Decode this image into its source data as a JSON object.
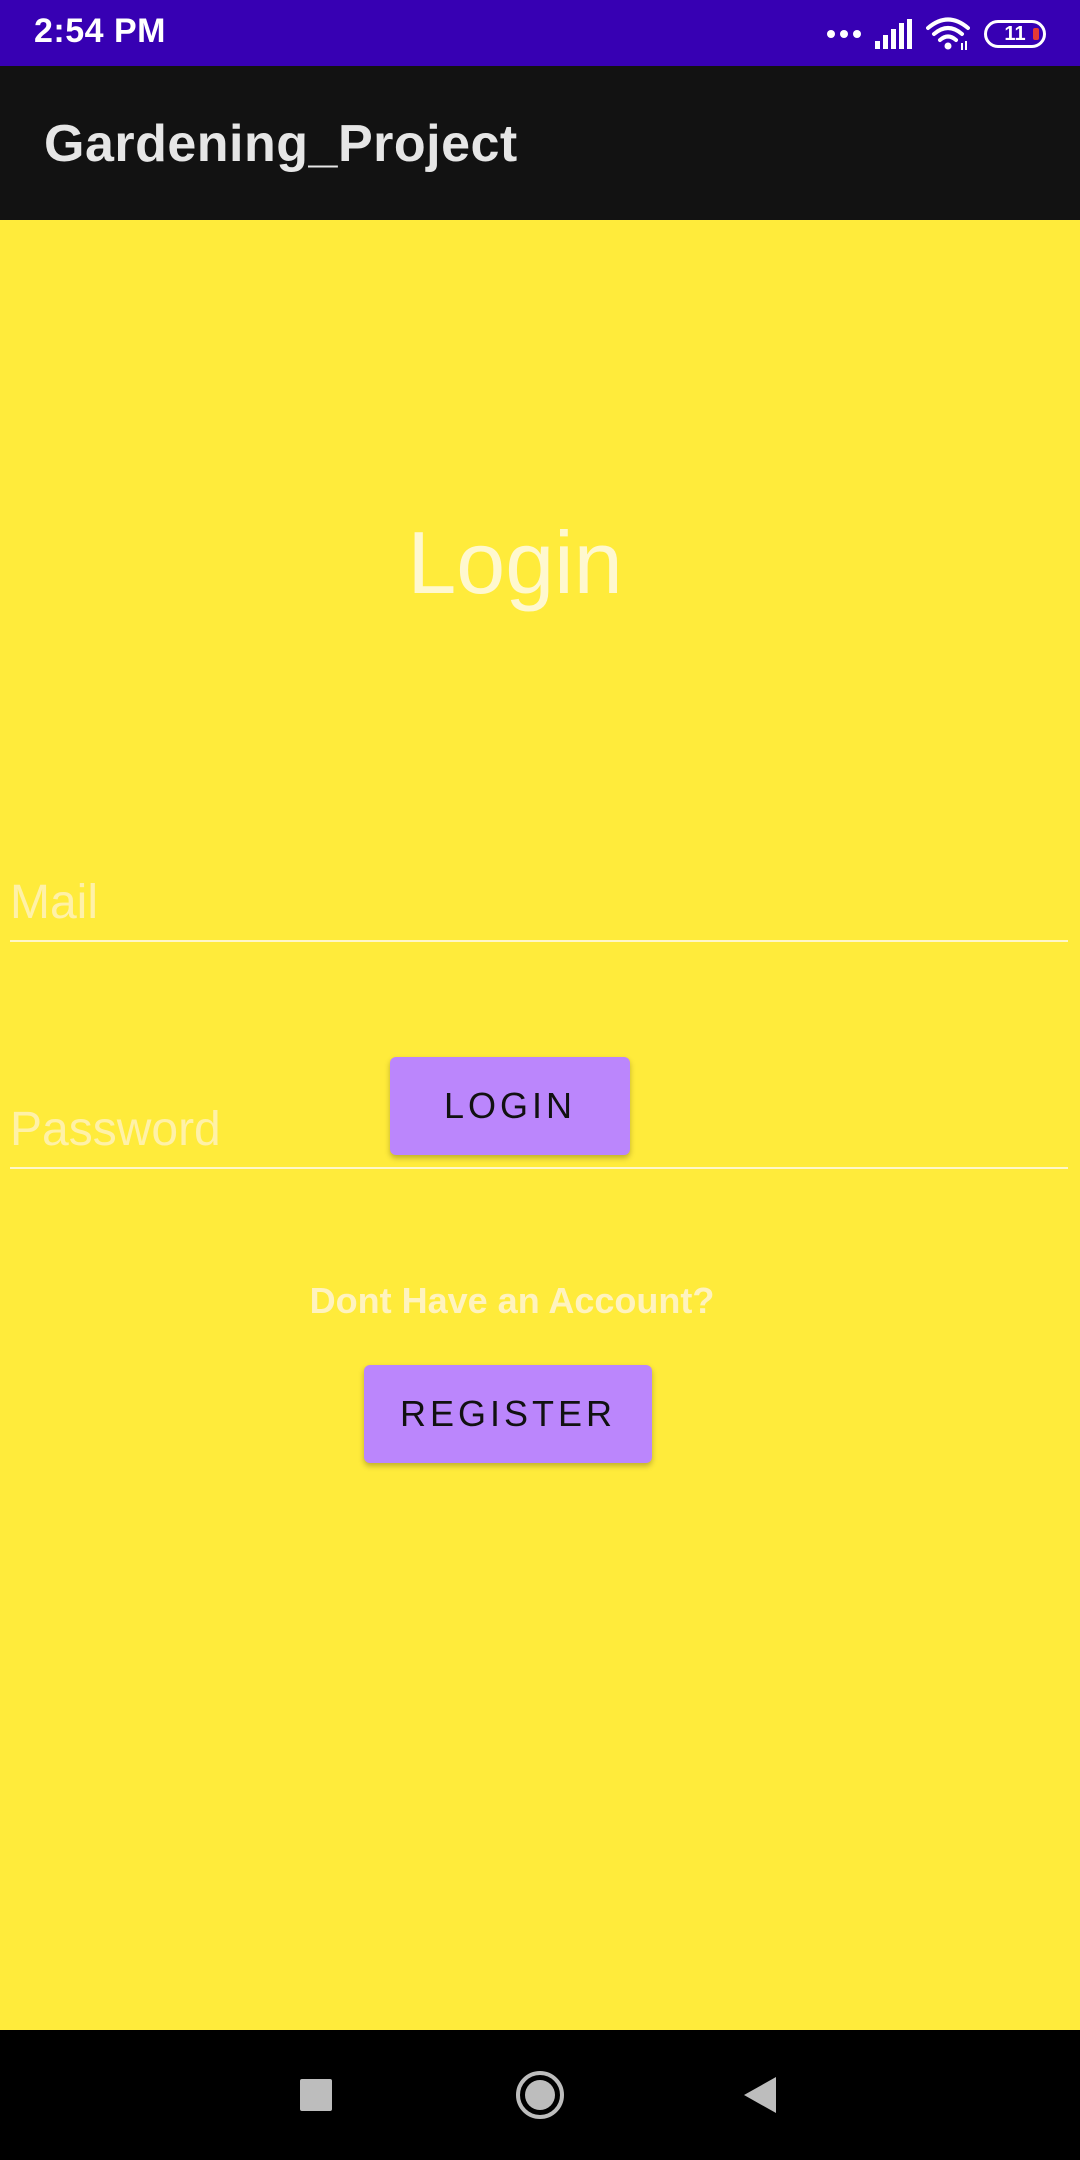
{
  "status_bar": {
    "time": "2:54 PM",
    "battery_level": "11",
    "icons": [
      "more-dots-icon",
      "signal-icon",
      "wifi-icon",
      "battery-icon"
    ]
  },
  "app_bar": {
    "title": "Gardening_Project"
  },
  "login_screen": {
    "title": "Login",
    "mail_placeholder": "Mail",
    "mail_value": "",
    "password_placeholder": "Password",
    "password_value": "",
    "login_button": "LOGIN",
    "no_account_text": "Dont Have an Account?",
    "register_button": "REGISTER"
  },
  "nav_bar": {
    "icons": [
      "recents-icon",
      "home-icon",
      "back-icon"
    ]
  },
  "colors": {
    "status_bar": "#3700b3",
    "app_bar": "#121212",
    "background": "#ffeb3b",
    "button": "#bb86fc"
  }
}
